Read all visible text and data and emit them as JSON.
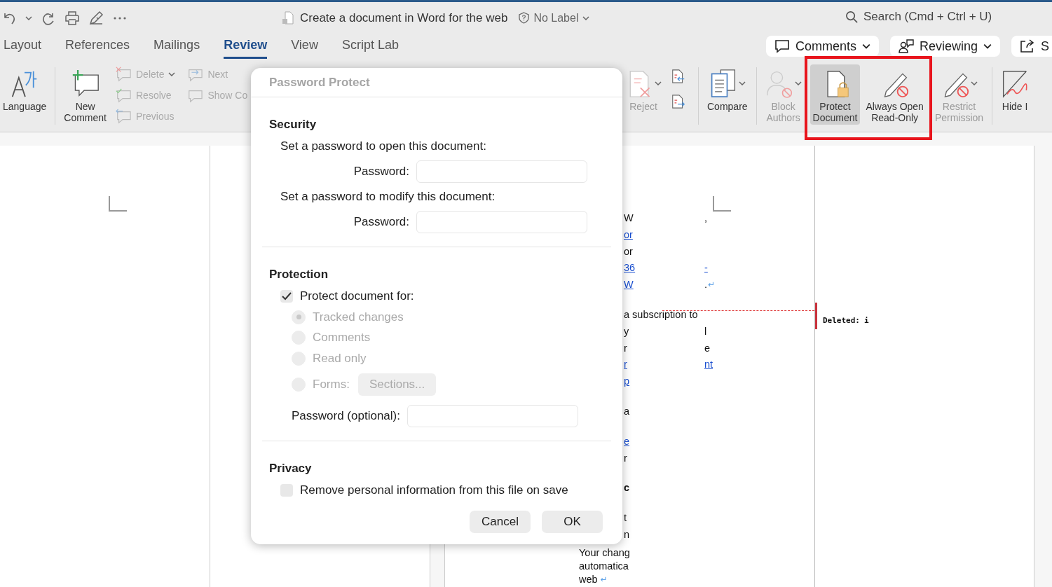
{
  "title_bar": {
    "document_title": "Create a document in Word for the web",
    "label": "No Label",
    "search": {
      "placeholder": "Search (Cmd + Ctrl + U)"
    }
  },
  "tabs": [
    {
      "label": "Layout",
      "selected": false
    },
    {
      "label": "References",
      "selected": false
    },
    {
      "label": "Mailings",
      "selected": false
    },
    {
      "label": "Review",
      "selected": true
    },
    {
      "label": "View",
      "selected": false
    },
    {
      "label": "Script Lab",
      "selected": false
    }
  ],
  "header_buttons": [
    {
      "label": "Comments",
      "caret": true
    },
    {
      "label": "Reviewing",
      "caret": true
    },
    {
      "label": "S"
    }
  ],
  "ribbon_left": [
    {
      "kind": "large",
      "label": "Language",
      "disabled": false,
      "pressed": false
    },
    {
      "kind": "separator"
    },
    {
      "kind": "large",
      "label": "New\nComment",
      "disabled": false,
      "pressed": false
    },
    {
      "kind": "stack",
      "items": [
        {
          "label": "Delete",
          "disabled": true,
          "caret": true
        },
        {
          "label": "Resolve",
          "disabled": true
        },
        {
          "label": "Previous",
          "disabled": true
        }
      ]
    },
    {
      "kind": "stack",
      "items": [
        {
          "label": "Next",
          "disabled": true
        },
        {
          "label": "Show Co",
          "disabled": true
        }
      ]
    }
  ],
  "ribbon_right": [
    {
      "kind": "large",
      "label": "Reject",
      "disabled": true,
      "pressed": false,
      "caret": true
    },
    {
      "kind": "iconstack",
      "items": [
        {
          "disabled": false
        },
        {
          "disabled": false
        }
      ]
    },
    {
      "kind": "separator"
    },
    {
      "kind": "large",
      "label": "Compare",
      "disabled": false,
      "pressed": false,
      "caret": true
    },
    {
      "kind": "separator"
    },
    {
      "kind": "large",
      "label": "Block\nAuthors",
      "disabled": true,
      "pressed": false,
      "caret": true
    },
    {
      "kind": "highlight",
      "items": [
        {
          "label": "Protect\nDocument",
          "disabled": false,
          "pressed": true
        },
        {
          "label": "Always Open\nRead-Only",
          "disabled": false,
          "pressed": false
        }
      ]
    },
    {
      "kind": "large",
      "label": "Restrict\nPermission",
      "disabled": true,
      "pressed": false,
      "caret": true
    },
    {
      "kind": "separator"
    },
    {
      "kind": "large",
      "label": "Hide I",
      "disabled": false,
      "pressed": false
    }
  ],
  "document": {
    "lines": [
      {
        "kind": "clipped",
        "left": [
          {
            "kind": "text",
            "text": "W"
          }
        ],
        "right": [
          {
            "kind": "text",
            "text": ","
          }
        ]
      },
      {
        "kind": "clipped",
        "left": [
          {
            "kind": "link",
            "text": "or"
          }
        ]
      },
      {
        "kind": "clipped",
        "left": [
          {
            "kind": "text",
            "text": "or"
          }
        ]
      },
      {
        "kind": "clipped",
        "left": [
          {
            "kind": "link",
            "text": "36"
          }
        ],
        "right": [
          {
            "kind": "link",
            "text": "-"
          }
        ]
      },
      {
        "kind": "clipped",
        "left": [
          {
            "kind": "link",
            "text": "W"
          }
        ],
        "right": [
          {
            "kind": "text",
            "text": "."
          },
          {
            "kind": "mark",
            "text": "↵"
          }
        ]
      },
      {
        "kind": "blank"
      },
      {
        "kind": "clipped",
        "left": [
          {
            "kind": "text",
            "text": "a subscription to"
          }
        ]
      },
      {
        "kind": "clipped",
        "left": [
          {
            "kind": "text",
            "text": "y"
          }
        ],
        "right": [
          {
            "kind": "text",
            "text": "l"
          }
        ]
      },
      {
        "kind": "clipped",
        "left": [
          {
            "kind": "text",
            "text": "r"
          }
        ],
        "right": [
          {
            "kind": "text",
            "text": "e"
          }
        ]
      },
      {
        "kind": "clipped",
        "left": [
          {
            "kind": "link",
            "text": "r"
          }
        ],
        "right": [
          {
            "kind": "link",
            "text": "nt"
          }
        ]
      },
      {
        "kind": "clipped",
        "left": [
          {
            "kind": "link",
            "text": "p"
          }
        ]
      },
      {
        "kind": "blank"
      },
      {
        "kind": "clipped",
        "left": [
          {
            "kind": "text",
            "text": "a"
          }
        ]
      },
      {
        "kind": "blank"
      },
      {
        "kind": "clipped",
        "left": [
          {
            "kind": "link",
            "text": "e"
          }
        ]
      },
      {
        "kind": "clipped",
        "left": [
          {
            "kind": "text",
            "text": "r"
          }
        ]
      },
      {
        "kind": "blank"
      },
      {
        "kind": "clipped",
        "left": [
          {
            "kind": "bold",
            "text": "c"
          }
        ]
      },
      {
        "kind": "blank"
      },
      {
        "kind": "clipped",
        "left": [
          {
            "kind": "text",
            "text": "t"
          }
        ]
      },
      {
        "kind": "clipped",
        "left": [
          {
            "kind": "text",
            "text": "n"
          }
        ]
      },
      {
        "kind": "full",
        "left": [
          {
            "kind": "text",
            "text": "Your chang"
          }
        ]
      },
      {
        "kind": "full",
        "left": [
          {
            "kind": "text",
            "text": "automatica"
          }
        ]
      },
      {
        "kind": "full",
        "left": [
          {
            "kind": "text",
            "text": "web"
          },
          {
            "kind": "mark",
            "text": "↵"
          }
        ]
      }
    ],
    "comment": {
      "label": "Deleted:",
      "text": "i"
    }
  },
  "dialog": {
    "title": "Password Protect",
    "security": {
      "heading": "Security",
      "open_label": "Set a password to open this document:",
      "open_password_label": "Password:",
      "modify_label": "Set a password to modify this document:",
      "modify_password_label": "Password:"
    },
    "protection": {
      "heading": "Protection",
      "protect_label": "Protect document for:",
      "checked": true,
      "options": [
        {
          "label": "Tracked changes",
          "selected": true,
          "disabled": true
        },
        {
          "label": "Comments",
          "selected": false,
          "disabled": true
        },
        {
          "label": "Read only",
          "selected": false,
          "disabled": true
        },
        {
          "label": "Forms:",
          "selected": false,
          "disabled": true
        }
      ],
      "sections_button": "Sections...",
      "password_label": "Password (optional):"
    },
    "privacy": {
      "heading": "Privacy",
      "remove_label": "Remove personal information from this file on save",
      "checked": false
    },
    "buttons": [
      "Cancel",
      "OK"
    ]
  }
}
